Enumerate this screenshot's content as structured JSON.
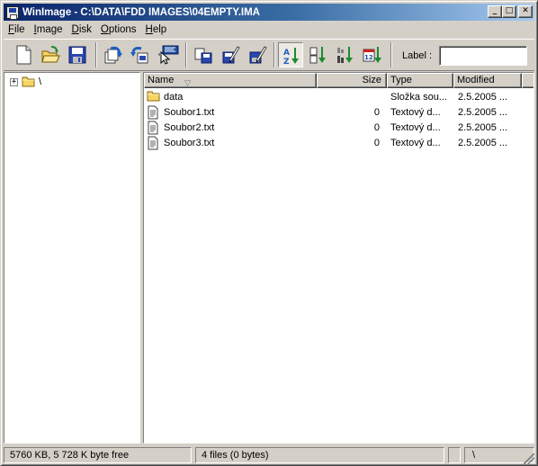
{
  "window": {
    "title": "WinImage - C:\\DATA\\FDD IMAGES\\04EMPTY.IMA",
    "minimize": "_",
    "maximize": "□",
    "close": "✕"
  },
  "menu": [
    {
      "pre": "",
      "acc": "F",
      "post": "ile"
    },
    {
      "pre": "",
      "acc": "I",
      "post": "mage"
    },
    {
      "pre": "",
      "acc": "D",
      "post": "isk"
    },
    {
      "pre": "",
      "acc": "O",
      "post": "ptions"
    },
    {
      "pre": "",
      "acc": "H",
      "post": "elp"
    }
  ],
  "toolbar": {
    "buttons": [
      "new-icon",
      "open-icon",
      "save-icon",
      "extract-icon",
      "inject-icon",
      "select-icon",
      "read-disk-icon",
      "write-disk-icon",
      "format-write-icon",
      "sort-name-icon",
      "sort-type-icon",
      "sort-size-icon",
      "sort-date-icon"
    ],
    "label_text": "Label :",
    "label_value": ""
  },
  "tree": {
    "expander": "+",
    "root_label": "\\"
  },
  "list": {
    "columns": {
      "name": "Name",
      "size": "Size",
      "type": "Type",
      "modified": "Modified"
    },
    "sort_indicator": "▽",
    "rows": [
      {
        "icon": "folder-icon",
        "name": "data",
        "size": "",
        "type": "Složka sou...",
        "modified": "2.5.2005 ..."
      },
      {
        "icon": "text-file-icon",
        "name": "Soubor1.txt",
        "size": "0",
        "type": "Textový d...",
        "modified": "2.5.2005 ..."
      },
      {
        "icon": "text-file-icon",
        "name": "Soubor2.txt",
        "size": "0",
        "type": "Textový d...",
        "modified": "2.5.2005 ..."
      },
      {
        "icon": "text-file-icon",
        "name": "Soubor3.txt",
        "size": "0",
        "type": "Textový d...",
        "modified": "2.5.2005 ..."
      }
    ]
  },
  "status": {
    "disk_info": "5760 KB, 5 728 K byte free",
    "files_info": "4 files (0 bytes)",
    "path": "\\"
  },
  "colors": {
    "title_start": "#0a246a",
    "title_end": "#a6caf0",
    "face": "#d4d0c8",
    "folder": "#f5d565",
    "sort_arrow": "#1c8a2c"
  }
}
